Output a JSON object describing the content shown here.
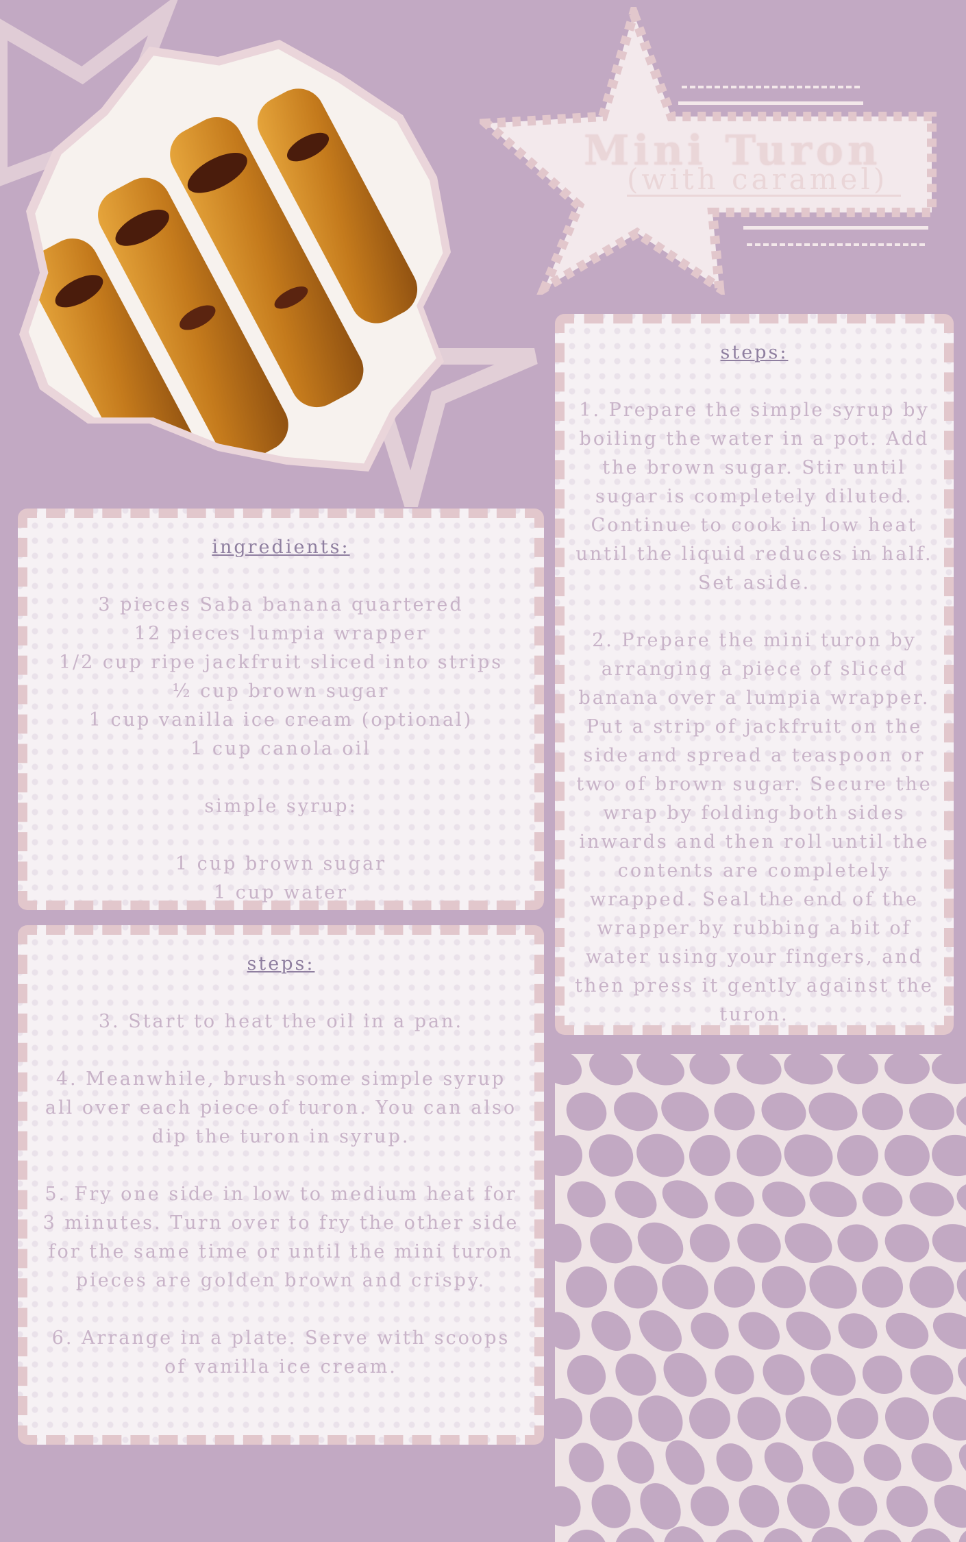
{
  "title": {
    "main": "Mini Turon",
    "sub": "(with caramel)"
  },
  "photo": {
    "alt": "Mini turon rolls drizzled with caramel"
  },
  "ingredients": {
    "heading": "ingredients:",
    "items": [
      "3 pieces Saba banana quartered",
      "12 pieces lumpia wrapper",
      "1/2 cup ripe jackfruit sliced into strips",
      "½ cup brown sugar",
      "1 cup vanilla ice cream (optional)",
      "1 cup canola oil"
    ],
    "syrup_heading": "simple syrup:",
    "syrup_items": [
      "1 cup brown sugar",
      "1 cup water"
    ]
  },
  "steps_right": {
    "heading": "steps:",
    "steps": [
      "1. Prepare the simple syrup by boiling the water in a pot. Add the brown sugar. Stir until sugar is completely diluted. Continue to cook in low heat until the liquid reduces in half. Set aside.",
      "2. Prepare the mini turon by arranging a piece of sliced banana over a lumpia wrapper. Put a strip of jackfruit on the side and spread a teaspoon or two of brown sugar. Secure the wrap by folding both sides inwards and then roll until the contents are completely wrapped. Seal the end of the wrapper by rubbing a bit of water using your fingers, and then press it gently against the turon."
    ]
  },
  "steps_left": {
    "heading": "steps:",
    "steps": [
      "3. Start to heat the oil in a pan.",
      "4. Meanwhile, brush some simple syrup all over each piece of turon. You can also dip the turon in syrup.",
      "5. Fry one side in low to medium heat for 3 minutes. Turn over to fry the other side for the same time or until the mini turon pieces are golden brown and crispy.",
      "6. Arrange in a plate. Serve with scoops of vanilla ice cream."
    ]
  },
  "colors": {
    "background": "#c2a9c3",
    "card_border": "#e2c7cc",
    "heading": "#8f7fa0",
    "body_text": "#c8b3c8",
    "title": "#ead6d8"
  }
}
